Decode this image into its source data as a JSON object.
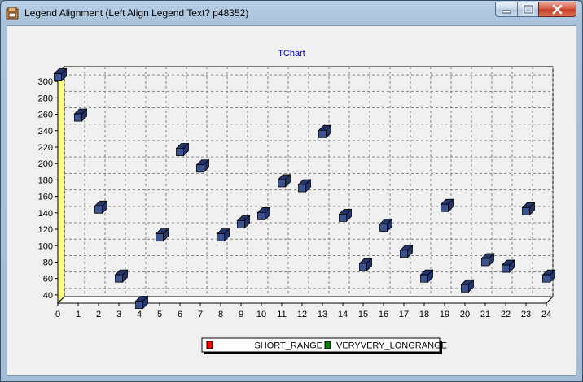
{
  "window": {
    "title": "Legend Alignment (Left Align Legend Text? p48352)",
    "icon": "app-icon"
  },
  "colors": {
    "axis_wall": "#ffff80",
    "cube_front": "#3b5391",
    "cube_top": "#22346a",
    "legend_short": "#ff0000",
    "legend_long": "#008000",
    "title": "#0000cc"
  },
  "chart_data": {
    "type": "scatter",
    "title": "TChart",
    "xlabel": "",
    "ylabel": "",
    "xlim": [
      0,
      24
    ],
    "ylim": [
      30,
      310
    ],
    "x_ticks": [
      0,
      1,
      2,
      3,
      4,
      5,
      6,
      7,
      8,
      9,
      10,
      11,
      12,
      13,
      14,
      15,
      16,
      17,
      18,
      19,
      20,
      21,
      22,
      23,
      24
    ],
    "y_ticks": [
      40,
      60,
      80,
      100,
      120,
      140,
      160,
      180,
      200,
      220,
      240,
      260,
      280,
      300
    ],
    "grid": true,
    "view3d": true,
    "legend_position": "bottom",
    "series": [
      {
        "x": [
          0,
          1,
          2,
          3,
          4,
          5,
          6,
          7,
          8,
          9,
          10,
          11,
          12,
          13,
          14,
          15,
          16,
          17,
          18,
          19,
          20,
          21,
          22,
          23,
          24
        ],
        "y": [
          305,
          256,
          144,
          60,
          28,
          110,
          214,
          194,
          110,
          126,
          136,
          176,
          170,
          236,
          134,
          74,
          122,
          90,
          60,
          146,
          48,
          80,
          72,
          142,
          60
        ]
      }
    ],
    "legend": [
      "SHORT_RANGE",
      "VERYVERY_LONGRANGE"
    ]
  }
}
